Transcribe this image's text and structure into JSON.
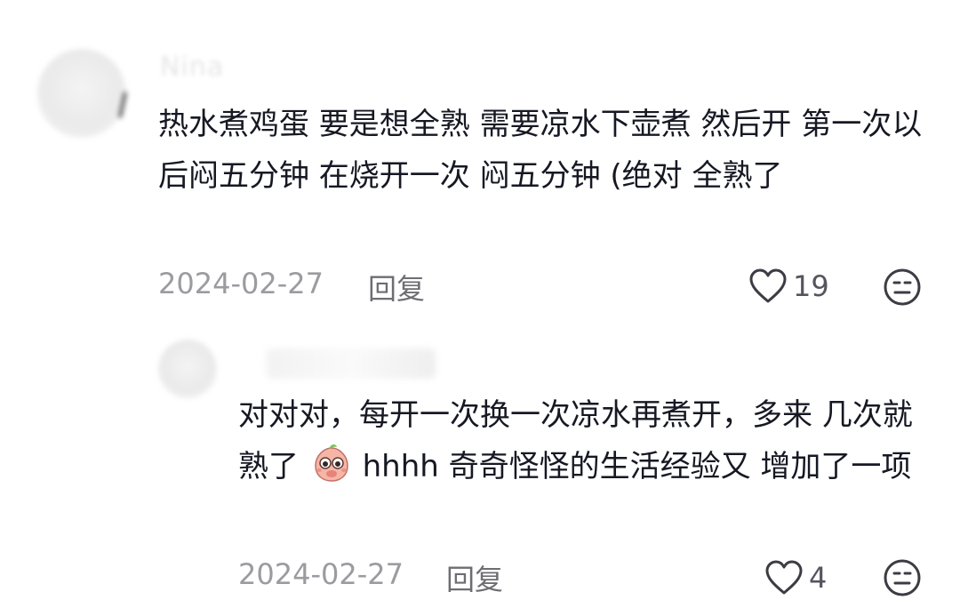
{
  "comment": {
    "username": "Nina",
    "text": "热水煮鸡蛋 要是想全熟 需要凉水下壶煮 然后开 第一次以后闷五分钟 在烧开一次 闷五分钟 (绝对 全熟了",
    "date": "2024-02-27",
    "reply_label": "回复",
    "likes": "19",
    "icons": {
      "like": "heart-outline-icon",
      "dislike": "neutral-face-icon"
    }
  },
  "reply": {
    "text_before_emoji": "对对对，每开一次换一次凉水再煮开，多来 几次就熟了",
    "emoji": "shy-face-emoji",
    "text_after_emoji": "hhhh 奇奇怪怪的生活经验又 增加了一项",
    "date": "2024-02-27",
    "reply_label": "回复",
    "likes": "4",
    "icons": {
      "like": "heart-outline-icon",
      "dislike": "neutral-face-icon"
    }
  }
}
